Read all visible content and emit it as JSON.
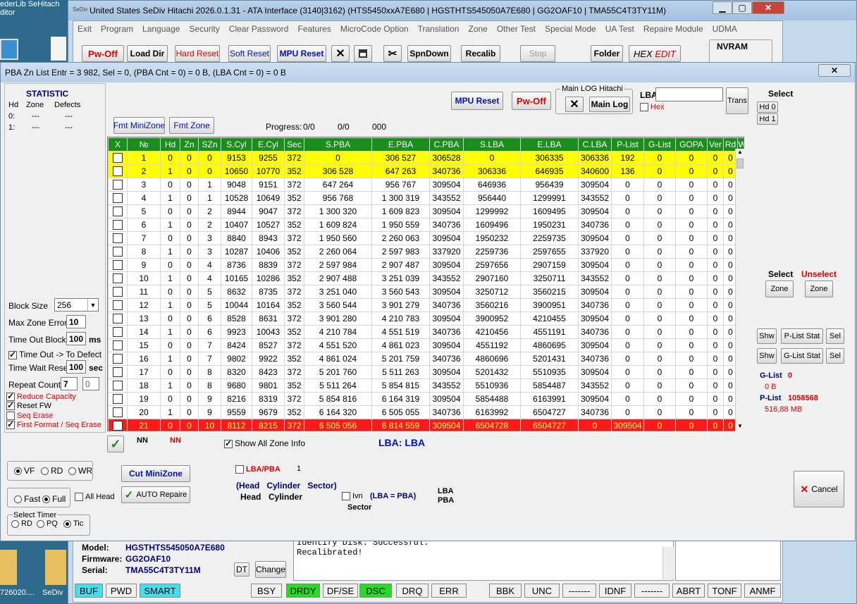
{
  "desktop": {
    "corner_text1": "ederLib   SeHitach",
    "corner_text2": "ditor",
    "file_label1": "726020....",
    "file_label2": "SeDiv"
  },
  "main_window": {
    "title": "United States  SeDiv Hitachi  2026.0.1.31 - ATA Interface  (3140|3162)  (HTS5450xxA7E680  |  HGSTHTS545050A7E680  |  GG2OAF10  |  TMA55C4T3TY11M)",
    "menu": [
      "Exit",
      "Program",
      "Language",
      "Security",
      "Clear Password",
      "Features",
      "MicroCode Option",
      "Translation",
      "Zone",
      "Other Test",
      "Special Mode",
      "UA Test",
      "Repaire Module",
      "UDMA"
    ],
    "toolbar": {
      "pw_off": "Pw-Off",
      "load_dir": "Load Dir",
      "hard_reset": "Hard Reset",
      "soft_reset": "Soft Reset",
      "mpu_reset": "MPU Reset",
      "spndown": "SpnDown",
      "recalib": "Recalib",
      "stop": "Stop",
      "folder": "Folder",
      "hex_edit_1": "HEX",
      "hex_edit_2": "EDIT",
      "nvram": "NVRAM"
    },
    "info": {
      "model_label": "Model:",
      "model": "HGSTHTS545050A7E680",
      "firmware_label": "Firmware:",
      "firmware": "GG2OAF10",
      "serial_label": "Serial:",
      "serial": "TMA55C4T3TY11M",
      "dt": "DT",
      "change": "Change",
      "log_line1": "Identify Disk: Successful.",
      "log_line2": "Recalibrated!"
    },
    "status": {
      "buf": "BUF",
      "pwd": "PWD",
      "smart": "SMART",
      "bsy": "BSY",
      "drdy": "DRDY",
      "dfse": "DF/SE",
      "dsc": "DSC",
      "drq": "DRQ",
      "err": "ERR",
      "bbk": "BBK",
      "unc": "UNC",
      "dash1": "-------",
      "idnf": "IDNF",
      "dash2": "-------",
      "abrt": "ABRT",
      "tonf": "TONF",
      "anmf": "ANMF"
    }
  },
  "dialog": {
    "title": "PBA Zn List Entr = 3 982, Sel = 0, (PBA Cnt = 0) = 0 B, (LBA Cnt = 0) = 0 B",
    "statistic": {
      "title": "STATISTIC",
      "col_hd": "Hd",
      "col_zone": "Zone",
      "col_defects": "Defects",
      "rows": [
        {
          "hd": "0:",
          "zone": "---",
          "defects": "---"
        },
        {
          "hd": "1:",
          "zone": "---",
          "defects": "---"
        }
      ]
    },
    "buttons": {
      "mpu_reset": "MPU Reset",
      "pw_off": "Pw-Off",
      "main_log_group": "Main LOG Hitachi",
      "main_log": "Main Log",
      "trans": "Trans",
      "fmt_minizone": "Fmt MiniZone",
      "fmt_zone": "Fmt Zone",
      "cut_minizone": "Cut MiniZone",
      "auto_repaire": "AUTO Repaire",
      "cancel": "Cancel"
    },
    "lba_label": "LBA",
    "lba_value": "",
    "hex_label": "Hex",
    "progress": {
      "label": "Progress:",
      "v1": "0/0",
      "v2": "0/0",
      "v3": "000"
    },
    "select": {
      "title": "Select",
      "hd0": "Hd 0",
      "hd1": "Hd 1"
    },
    "zone_select": {
      "select": "Select",
      "unselect": "Unselect",
      "zone": "Zone"
    },
    "shw_rows": [
      {
        "shw": "Shw",
        "stat": "P-List Stat",
        "sel": "Sel"
      },
      {
        "shw": "Shw",
        "stat": "G-List Stat",
        "sel": "Sel"
      }
    ],
    "glist": {
      "label": "G-List",
      "value": "0",
      "size": "0 B"
    },
    "plist": {
      "label": "P-List",
      "value": "1058568",
      "size": "516,88 MB"
    },
    "params": {
      "block_size_label": "Block Size",
      "block_size": "256",
      "max_zone_error_label": "Max Zone Error",
      "max_zone_error": "10",
      "time_out_block_label": "Time Out Block",
      "time_out_block": "100",
      "ms": "ms",
      "time_out_defect": "Time Out  -> To Defect",
      "time_wait_reset_label": "Time Wait Reset",
      "time_wait_reset": "100",
      "sec": "sec",
      "repeat_count_label": "Repeat Count",
      "repeat_count": "7",
      "repeat_count2": "0",
      "reduce_capacity": "Reduce Capacity",
      "reset_fw": "Reset FW",
      "seq_erase": "Seq Erase",
      "first_format": "First Format / Seq Erase"
    },
    "bottom": {
      "nn1": "NN",
      "nn2": "NN",
      "show_all_zone": "Show All Zone Info",
      "lba_lba": "LBA: LBA",
      "vf": "VF",
      "rd": "RD",
      "wr": "WR",
      "fast": "Fast",
      "full": "Full",
      "all_head": "All Head",
      "select_timer": "Select Timer",
      "t_rd": "RD",
      "t_pq": "PQ",
      "t_tic": "Tic",
      "lba_pba": "LBA/PBA",
      "lba_pba_val": "1",
      "head_cyl_sector": "(Head   Cylinder   Sector)",
      "head": "Head",
      "cylinder": "Cylinder",
      "ivn": "Ivn",
      "lba_eq_pba": "(LBA = PBA)",
      "sector": "Sector",
      "lba_word": "LBA",
      "pba_word": "PBA"
    },
    "table": {
      "headers": [
        "X",
        "№",
        "Hd",
        "Zn",
        "SZn",
        "S.Cyl",
        "E.Cyl",
        "Sec",
        "S.PBA",
        "E.PBA",
        "C.PBA",
        "S.LBA",
        "E.LBA",
        "C.LBA",
        "P-List",
        "G-List",
        "GOPA",
        "Ver",
        "Rd",
        "Wr"
      ],
      "rows": [
        [
          "1",
          "0",
          "0",
          "0",
          "9153",
          "9255",
          "372",
          "0",
          "306 527",
          "306528",
          "0",
          "306335",
          "306336",
          "192",
          "0",
          "0",
          "0",
          "0",
          "0"
        ],
        [
          "2",
          "1",
          "0",
          "0",
          "10650",
          "10770",
          "352",
          "306 528",
          "647 263",
          "340736",
          "306336",
          "646935",
          "340600",
          "136",
          "0",
          "0",
          "0",
          "0",
          "0"
        ],
        [
          "3",
          "0",
          "0",
          "1",
          "9048",
          "9151",
          "372",
          "647 264",
          "956 767",
          "309504",
          "646936",
          "956439",
          "309504",
          "0",
          "0",
          "0",
          "0",
          "0",
          "0"
        ],
        [
          "4",
          "1",
          "0",
          "1",
          "10528",
          "10649",
          "352",
          "956 768",
          "1 300 319",
          "343552",
          "956440",
          "1299991",
          "343552",
          "0",
          "0",
          "0",
          "0",
          "0",
          "0"
        ],
        [
          "5",
          "0",
          "0",
          "2",
          "8944",
          "9047",
          "372",
          "1 300 320",
          "1 609 823",
          "309504",
          "1299992",
          "1609495",
          "309504",
          "0",
          "0",
          "0",
          "0",
          "0",
          "0"
        ],
        [
          "6",
          "1",
          "0",
          "2",
          "10407",
          "10527",
          "352",
          "1 609 824",
          "1 950 559",
          "340736",
          "1609496",
          "1950231",
          "340736",
          "0",
          "0",
          "0",
          "0",
          "0",
          "0"
        ],
        [
          "7",
          "0",
          "0",
          "3",
          "8840",
          "8943",
          "372",
          "1 950 560",
          "2 260 063",
          "309504",
          "1950232",
          "2259735",
          "309504",
          "0",
          "0",
          "0",
          "0",
          "0",
          "0"
        ],
        [
          "8",
          "1",
          "0",
          "3",
          "10287",
          "10406",
          "352",
          "2 260 064",
          "2 597 983",
          "337920",
          "2259736",
          "2597655",
          "337920",
          "0",
          "0",
          "0",
          "0",
          "0",
          "0"
        ],
        [
          "9",
          "0",
          "0",
          "4",
          "8736",
          "8839",
          "372",
          "2 597 984",
          "2 907 487",
          "309504",
          "2597656",
          "2907159",
          "309504",
          "0",
          "0",
          "0",
          "0",
          "0",
          "0"
        ],
        [
          "10",
          "1",
          "0",
          "4",
          "10165",
          "10286",
          "352",
          "2 907 488",
          "3 251 039",
          "343552",
          "2907160",
          "3250711",
          "343552",
          "0",
          "0",
          "0",
          "0",
          "0",
          "0"
        ],
        [
          "11",
          "0",
          "0",
          "5",
          "8632",
          "8735",
          "372",
          "3 251 040",
          "3 560 543",
          "309504",
          "3250712",
          "3560215",
          "309504",
          "0",
          "0",
          "0",
          "0",
          "0",
          "0"
        ],
        [
          "12",
          "1",
          "0",
          "5",
          "10044",
          "10164",
          "352",
          "3 560 544",
          "3 901 279",
          "340736",
          "3560216",
          "3900951",
          "340736",
          "0",
          "0",
          "0",
          "0",
          "0",
          "0"
        ],
        [
          "13",
          "0",
          "0",
          "6",
          "8528",
          "8631",
          "372",
          "3 901 280",
          "4 210 783",
          "309504",
          "3900952",
          "4210455",
          "309504",
          "0",
          "0",
          "0",
          "0",
          "0",
          "0"
        ],
        [
          "14",
          "1",
          "0",
          "6",
          "9923",
          "10043",
          "352",
          "4 210 784",
          "4 551 519",
          "340736",
          "4210456",
          "4551191",
          "340736",
          "0",
          "0",
          "0",
          "0",
          "0",
          "0"
        ],
        [
          "15",
          "0",
          "0",
          "7",
          "8424",
          "8527",
          "372",
          "4 551 520",
          "4 861 023",
          "309504",
          "4551192",
          "4860695",
          "309504",
          "0",
          "0",
          "0",
          "0",
          "0",
          "0"
        ],
        [
          "16",
          "1",
          "0",
          "7",
          "9802",
          "9922",
          "352",
          "4 861 024",
          "5 201 759",
          "340736",
          "4860696",
          "5201431",
          "340736",
          "0",
          "0",
          "0",
          "0",
          "0",
          "0"
        ],
        [
          "17",
          "0",
          "0",
          "8",
          "8320",
          "8423",
          "372",
          "5 201 760",
          "5 511 263",
          "309504",
          "5201432",
          "5510935",
          "309504",
          "0",
          "0",
          "0",
          "0",
          "0",
          "0"
        ],
        [
          "18",
          "1",
          "0",
          "8",
          "9680",
          "9801",
          "352",
          "5 511 264",
          "5 854 815",
          "343552",
          "5510936",
          "5854487",
          "343552",
          "0",
          "0",
          "0",
          "0",
          "0",
          "0"
        ],
        [
          "19",
          "0",
          "0",
          "9",
          "8216",
          "8319",
          "372",
          "5 854 816",
          "6 164 319",
          "309504",
          "5854488",
          "6163991",
          "309504",
          "0",
          "0",
          "0",
          "0",
          "0",
          "0"
        ],
        [
          "20",
          "1",
          "0",
          "9",
          "9559",
          "9679",
          "352",
          "6 164 320",
          "6 505 055",
          "340736",
          "6163992",
          "6504727",
          "340736",
          "0",
          "0",
          "0",
          "0",
          "0",
          "0"
        ],
        [
          "21",
          "0",
          "0",
          "10",
          "8112",
          "8215",
          "372",
          "6 505 056",
          "6 814 559",
          "309504",
          "6504728",
          "6504727",
          "0",
          "309504",
          "0",
          "0",
          "0",
          "0",
          "0"
        ]
      ],
      "row_styles": [
        "yel",
        "yel",
        "",
        "",
        "",
        "",
        "",
        "",
        "",
        "",
        "",
        "",
        "",
        "",
        "",
        "",
        "",
        "",
        "",
        "",
        "redr"
      ]
    }
  }
}
